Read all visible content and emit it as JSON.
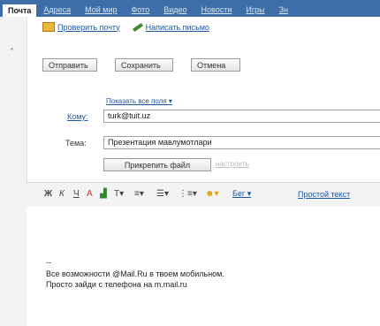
{
  "tabs": {
    "active": "Почта",
    "items": [
      "Адреса",
      "Мой мир",
      "Фото",
      "Видео",
      "Новости",
      "Игры",
      "Зн"
    ]
  },
  "sublinks": {
    "check_mail": "Проверить почту",
    "write_letter": "Написать письмо"
  },
  "actions": {
    "send": "Отправить",
    "save": "Сохранить",
    "cancel": "Отмена"
  },
  "compose": {
    "show_all_fields": "Показать все поля ▾",
    "to_label": "Кому:",
    "to_value": "turk@tuit.uz",
    "subject_label": "Тема:",
    "subject_value": "Презентация мавлумотлари",
    "attach_button": "Прикрепить файл",
    "delete_link": "настроить"
  },
  "toolbar": {
    "font_label": "Бег ▾",
    "plain_text": "Простой текст",
    "icons": [
      "bold-icon",
      "italic-icon",
      "underline-icon",
      "text-color-icon",
      "highlight-icon",
      "font-size-icon",
      "align-icon",
      "list-icon",
      "numbered-list-icon",
      "smiley-icon"
    ]
  },
  "signature": {
    "dash": "--",
    "line1": "Все возможности @Mail.Ru в твоем мобильном.",
    "line2": "Просто зайди с телефона на m.mail.ru"
  },
  "colors": {
    "tab_bar": "#3d6ea8",
    "link": "#1d57a4",
    "toolbar_bg": "#f3f3f3"
  }
}
